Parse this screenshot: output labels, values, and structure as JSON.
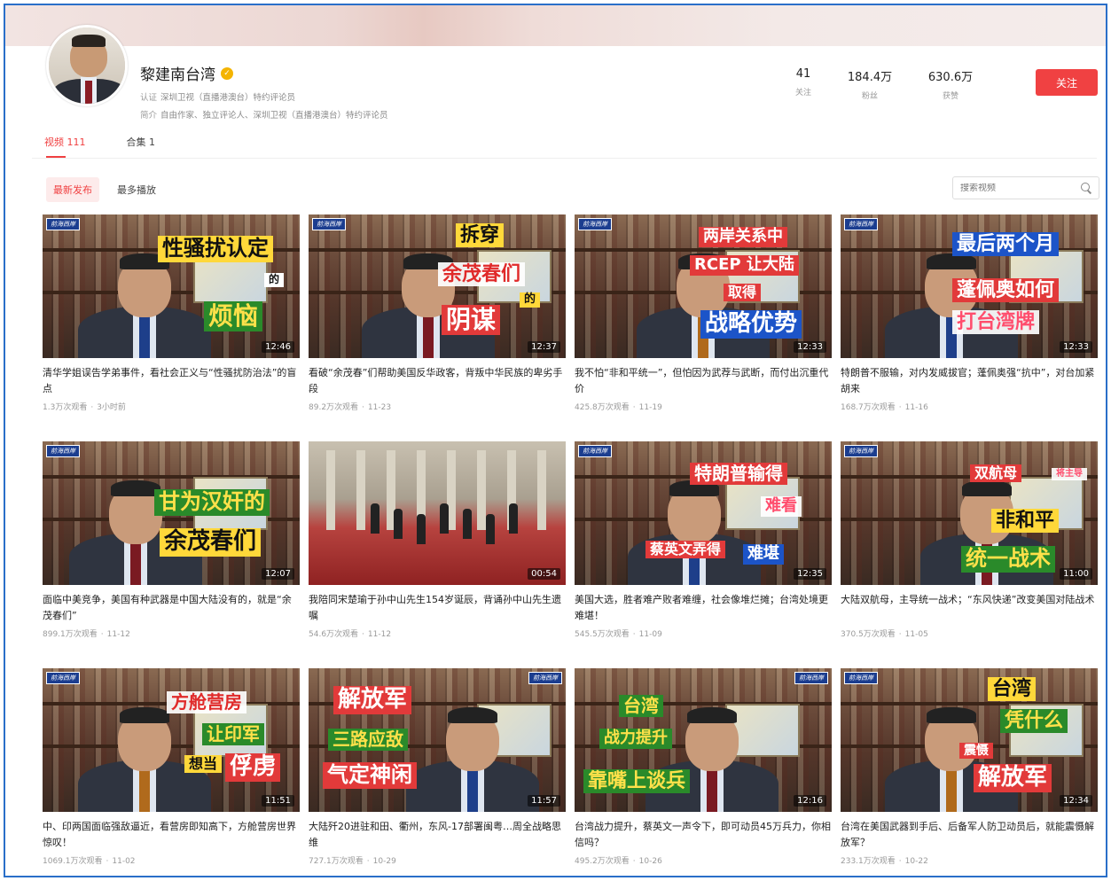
{
  "profile": {
    "name": "黎建南台湾",
    "meta1_key": "认证",
    "meta1_value": "深圳卫视（直播港澳台）特约评论员",
    "meta2_key": "简介",
    "meta2_value": "自由作家、独立评论人、深圳卫视（直播港澳台）特约评论员",
    "follow_label": "关注"
  },
  "stats": [
    {
      "value": "41",
      "label": "关注"
    },
    {
      "value": "184.4万",
      "label": "粉丝"
    },
    {
      "value": "630.6万",
      "label": "获赞"
    }
  ],
  "tabs": [
    {
      "label": "视频 111",
      "active": true
    },
    {
      "label": "合集 1",
      "active": false
    }
  ],
  "subtabs": [
    {
      "label": "最新发布",
      "active": true
    },
    {
      "label": "最多播放",
      "active": false
    }
  ],
  "search": {
    "placeholder": "搜索视频"
  },
  "videos": [
    {
      "title": "清华学姐误告学弟事件，看社会正义与“性骚扰防治法”的盲点",
      "views": "1.3万次观看",
      "date": "3小时前",
      "duration": "12:46",
      "badge": "前海西岸"
    },
    {
      "title": "看破“余茂春”们帮助美国反华政客，背叛中华民族的卑劣手段",
      "views": "89.2万次观看",
      "date": "11-23",
      "duration": "12:37",
      "badge": "前海西岸"
    },
    {
      "title": "我不怕“非和平统一”，但怕因为武荐与武断，而付出沉重代价",
      "views": "425.8万次观看",
      "date": "11-19",
      "duration": "12:33",
      "badge": "前海西岸"
    },
    {
      "title": "特朗普不服输，对内发威拔官；蓬佩奥强“抗中”，对台加紧胡来",
      "views": "168.7万次观看",
      "date": "11-16",
      "duration": "12:33",
      "badge": "前海西岸"
    },
    {
      "title": "面临中美竞争，美国有种武器是中国大陆没有的，就是“余茂春们”",
      "views": "899.1万次观看",
      "date": "11-12",
      "duration": "12:07",
      "badge": "前海西岸"
    },
    {
      "title": "我陪同宋楚瑜于孙中山先生154岁诞辰，背诵孙中山先生遗嘱",
      "views": "54.6万次观看",
      "date": "11-12",
      "duration": "00:54",
      "badge": ""
    },
    {
      "title": "美国大选，胜者难产败者难缠，社会像堆烂摊；台湾处境更难堪！",
      "views": "545.5万次观看",
      "date": "11-09",
      "duration": "12:35",
      "badge": "前海西岸"
    },
    {
      "title": "大陆双航母，主导统一战术；“东风快递”改变美国对陆战术",
      "views": "370.5万次观看",
      "date": "11-05",
      "duration": "11:00",
      "badge": "前海西岸"
    },
    {
      "title": "中、印两国面临强敌逼近，看营房即知高下，方舱营房世界惊叹！",
      "views": "1069.1万次观看",
      "date": "11-02",
      "duration": "11:51",
      "badge": "前海西岸"
    },
    {
      "title": "大陆歼20进驻和田、衢州，东风-17部署闽粤…周全战略思维",
      "views": "727.1万次观看",
      "date": "10-29",
      "duration": "11:57",
      "badge": "前海西岸"
    },
    {
      "title": "台湾战力提升，蔡英文一声令下，即可动员45万兵力，你相信吗？",
      "views": "495.2万次观看",
      "date": "10-26",
      "duration": "12:16",
      "badge": "前海西岸"
    },
    {
      "title": "台湾在美国武器到手后、后备军人防卫动员后，就能震慑解放军？",
      "views": "233.1万次观看",
      "date": "10-22",
      "duration": "12:34",
      "badge": "前海西岸"
    }
  ],
  "captions": [
    [
      "性骚扰认定",
      "的",
      "烦恼"
    ],
    [
      "拆穿",
      "余茂春们",
      "的",
      "阴谋"
    ],
    [
      "两岸关系中",
      "RCEP 让大陆",
      "取得",
      "战略优势"
    ],
    [
      "最后两个月",
      "蓬佩奥如何",
      "打台湾牌"
    ],
    [
      "甘为汉奸的",
      "余茂春们"
    ],
    [],
    [
      "特朗普输得",
      "难看",
      "蔡英文弄得",
      "难堪"
    ],
    [
      "双航母",
      "将主导",
      "非和平",
      "统一战术"
    ],
    [
      "方舱营房",
      "让印军",
      "想当",
      "俘虏"
    ],
    [
      "解放军",
      "三路应敌",
      "气定神闲"
    ],
    [
      "台湾",
      "战力提升",
      "靠嘴上谈兵"
    ],
    [
      "台湾",
      "凭什么",
      "震慑",
      "解放军"
    ]
  ],
  "sep": "·"
}
